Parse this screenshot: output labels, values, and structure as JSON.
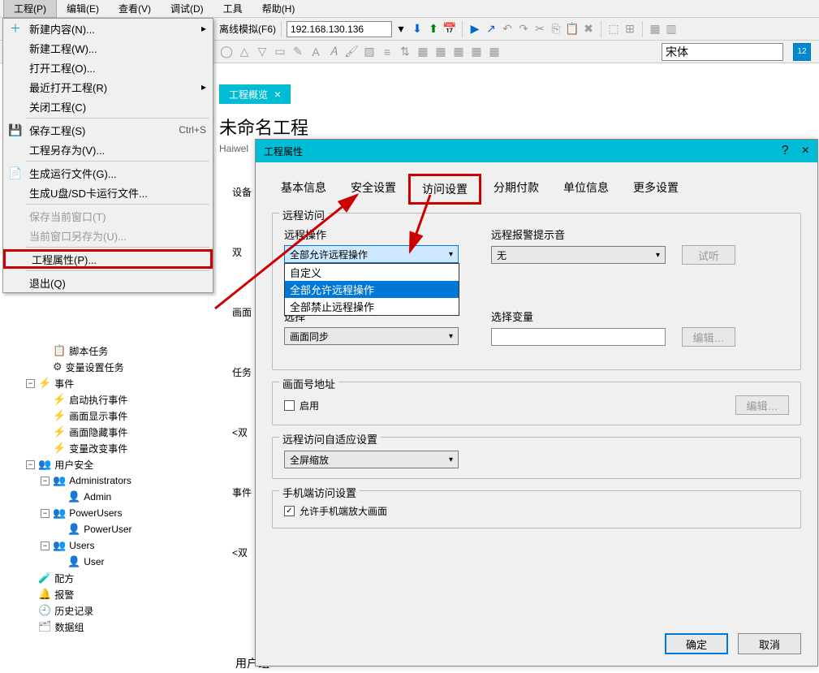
{
  "menubar": [
    "工程(P)",
    "编辑(E)",
    "查看(V)",
    "调试(D)",
    "工具",
    "帮助(H)"
  ],
  "toolbar": {
    "offline_sim": "离线模拟(F6)",
    "ip": "192.168.130.136",
    "font_name": "宋体"
  },
  "menu": {
    "items": [
      {
        "icon": "＋",
        "label": "新建内容(N)...",
        "arrow": true,
        "color": "#0aa"
      },
      {
        "icon": "",
        "label": "新建工程(W)..."
      },
      {
        "icon": "",
        "label": "打开工程(O)..."
      },
      {
        "icon": "",
        "label": "最近打开工程(R)",
        "arrow": true
      },
      {
        "icon": "",
        "label": "关闭工程(C)"
      },
      {
        "sep": true
      },
      {
        "icon": "💾",
        "label": "保存工程(S)",
        "shortcut": "Ctrl+S",
        "color": "#06c"
      },
      {
        "icon": "",
        "label": "工程另存为(V)..."
      },
      {
        "sep": true
      },
      {
        "icon": "📄",
        "label": "生成运行文件(G)...",
        "color": "#080"
      },
      {
        "icon": "",
        "label": "生成U盘/SD卡运行文件..."
      },
      {
        "sep": true
      },
      {
        "icon": "",
        "label": "保存当前窗口(T)",
        "disabled": true
      },
      {
        "icon": "",
        "label": "当前窗口另存为(U)...",
        "disabled": true
      },
      {
        "sep": true
      },
      {
        "icon": "",
        "label": "工程属性(P)...",
        "highlight": true
      },
      {
        "sep": true
      },
      {
        "icon": "",
        "label": "退出(Q)"
      }
    ]
  },
  "tab": {
    "label": "工程概览",
    "close": "×"
  },
  "page": {
    "title": "未命名工程",
    "sub": "Haiwel"
  },
  "side_labels": [
    "设备",
    "双",
    "画面",
    "任务",
    "<双",
    "事件",
    "<双"
  ],
  "side_bottom": "用户组",
  "tree": [
    {
      "icon": "📋",
      "label": "脚本任务",
      "indent": 2,
      "toggle": ""
    },
    {
      "icon": "⚙",
      "label": "变量设置任务",
      "indent": 2,
      "toggle": "",
      "iconColor": "#333"
    },
    {
      "icon": "⚡",
      "label": "事件",
      "indent": 1,
      "toggle": "−",
      "iconColor": "#f5a623"
    },
    {
      "icon": "⚡",
      "label": "启动执行事件",
      "indent": 2,
      "iconColor": "#f5a623"
    },
    {
      "icon": "⚡",
      "label": "画面显示事件",
      "indent": 2,
      "iconColor": "#f5a623"
    },
    {
      "icon": "⚡",
      "label": "画面隐藏事件",
      "indent": 2,
      "iconColor": "#f5a623"
    },
    {
      "icon": "⚡",
      "label": "变量改变事件",
      "indent": 2,
      "iconColor": "#f5a623"
    },
    {
      "icon": "👥",
      "label": "用户安全",
      "indent": 1,
      "toggle": "−"
    },
    {
      "icon": "👥",
      "label": "Administrators",
      "indent": 2,
      "toggle": "−",
      "iconColor": "#080"
    },
    {
      "icon": "👤",
      "label": "Admin",
      "indent": 3,
      "iconColor": "#06c"
    },
    {
      "icon": "👥",
      "label": "PowerUsers",
      "indent": 2,
      "toggle": "−",
      "iconColor": "#080"
    },
    {
      "icon": "👤",
      "label": "PowerUser",
      "indent": 3,
      "iconColor": "#06c"
    },
    {
      "icon": "👥",
      "label": "Users",
      "indent": 2,
      "toggle": "−",
      "iconColor": "#080"
    },
    {
      "icon": "👤",
      "label": "User",
      "indent": 3,
      "iconColor": "#06c"
    },
    {
      "icon": "🧪",
      "label": "配方",
      "indent": 1,
      "iconColor": "#2a8"
    },
    {
      "icon": "🔔",
      "label": "报警",
      "indent": 1,
      "iconColor": "#f5a623"
    },
    {
      "icon": "🕘",
      "label": "历史记录",
      "indent": 1,
      "iconColor": "#06c"
    },
    {
      "icon": "🗂",
      "label": "数据组",
      "indent": 1,
      "iconColor": "#888"
    }
  ],
  "dialog": {
    "title": "工程属性",
    "help": "?",
    "close": "×",
    "tabs": [
      "基本信息",
      "安全设置",
      "访问设置",
      "分期付款",
      "单位信息",
      "更多设置"
    ],
    "active_tab": 2,
    "groups": {
      "remote": {
        "title": "远程访问",
        "op_label": "远程操作",
        "op_value": "全部允许远程操作",
        "op_options": [
          "自定义",
          "全部允许远程操作",
          "全部禁止远程操作"
        ],
        "alarm_label": "远程报警提示音",
        "alarm_value": "无",
        "try_btn": "试听",
        "sel_label": "选择",
        "sel_value": "画面同步",
        "var_label": "选择变量",
        "edit_btn": "编辑…"
      },
      "addr": {
        "title": "画面号地址",
        "enable": "启用",
        "edit_btn": "编辑…"
      },
      "adapt": {
        "title": "远程访问自适应设置",
        "value": "全屏缩放"
      },
      "mobile": {
        "title": "手机端访问设置",
        "check": "允许手机端放大画面"
      }
    },
    "ok": "确定",
    "cancel": "取消"
  }
}
